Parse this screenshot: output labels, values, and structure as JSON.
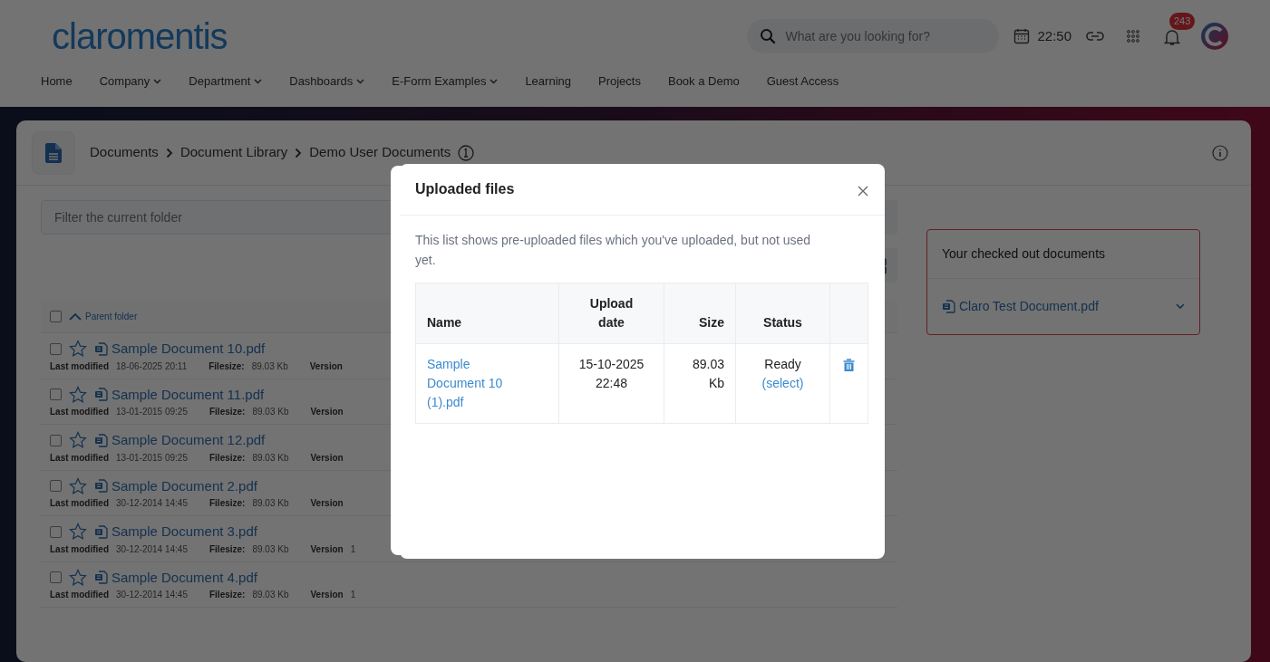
{
  "header": {
    "logo": "claromentis",
    "search": {
      "placeholder": "What are you looking for?"
    },
    "time": "22:50",
    "notifications": "243"
  },
  "nav": [
    {
      "label": "Home",
      "dropdown": false
    },
    {
      "label": "Company",
      "dropdown": true
    },
    {
      "label": "Department",
      "dropdown": true
    },
    {
      "label": "Dashboards",
      "dropdown": true
    },
    {
      "label": "E-Form Examples",
      "dropdown": true
    },
    {
      "label": "Learning",
      "dropdown": false
    },
    {
      "label": "Projects",
      "dropdown": false
    },
    {
      "label": "Book a Demo",
      "dropdown": false
    },
    {
      "label": "Guest Access",
      "dropdown": false
    }
  ],
  "breadcrumb": [
    "Documents",
    "Document Library",
    "Demo User Documents"
  ],
  "filter": {
    "placeholder": "Filter the current folder"
  },
  "parent_folder": {
    "label": "Parent folder",
    "checked": false
  },
  "documents": [
    {
      "name": "Sample Document 10.pdf",
      "checked": false,
      "starred": false,
      "modified_label": "Last modified",
      "modified": "18-06-2025 20:11",
      "filesize_label": "Filesize:",
      "filesize": "89.03 Kb",
      "version_label": "Version"
    },
    {
      "name": "Sample Document 11.pdf",
      "checked": false,
      "starred": false,
      "modified_label": "Last modified",
      "modified": "13-01-2015 09:25",
      "filesize_label": "Filesize:",
      "filesize": "89.03 Kb",
      "version_label": "Version"
    },
    {
      "name": "Sample Document 12.pdf",
      "checked": false,
      "starred": false,
      "modified_label": "Last modified",
      "modified": "13-01-2015 09:25",
      "filesize_label": "Filesize:",
      "filesize": "89.03 Kb",
      "version_label": "Version"
    },
    {
      "name": "Sample Document 2.pdf",
      "checked": false,
      "starred": false,
      "modified_label": "Last modified",
      "modified": "30-12-2014 14:45",
      "filesize_label": "Filesize:",
      "filesize": "89.03 Kb",
      "version_label": "Version"
    },
    {
      "name": "Sample Document 3.pdf",
      "checked": false,
      "starred": false,
      "modified_label": "Last modified",
      "modified": "30-12-2014 14:45",
      "filesize_label": "Filesize:",
      "filesize": "89.03 Kb",
      "version_label": "Version",
      "version": "1"
    },
    {
      "name": "Sample Document 4.pdf",
      "checked": false,
      "starred": false,
      "modified_label": "Last modified",
      "modified": "30-12-2014 14:45",
      "filesize_label": "Filesize:",
      "filesize": "89.03 Kb",
      "version_label": "Version",
      "version": "1"
    }
  ],
  "checked_out": {
    "title": "Your checked out documents",
    "items": [
      {
        "name": "Claro Test Document.pdf"
      }
    ]
  },
  "modal": {
    "title": "Uploaded files",
    "description": "This list shows pre-uploaded files which you've uploaded, but not used yet.",
    "columns": [
      "Name",
      "Upload date",
      "Size",
      "Status"
    ],
    "rows": [
      {
        "name": "Sample Document 10 (1).pdf",
        "date": "15-10-2025 22:48",
        "size": "89.03 Kb",
        "status": "Ready",
        "action": "(select)"
      }
    ]
  }
}
